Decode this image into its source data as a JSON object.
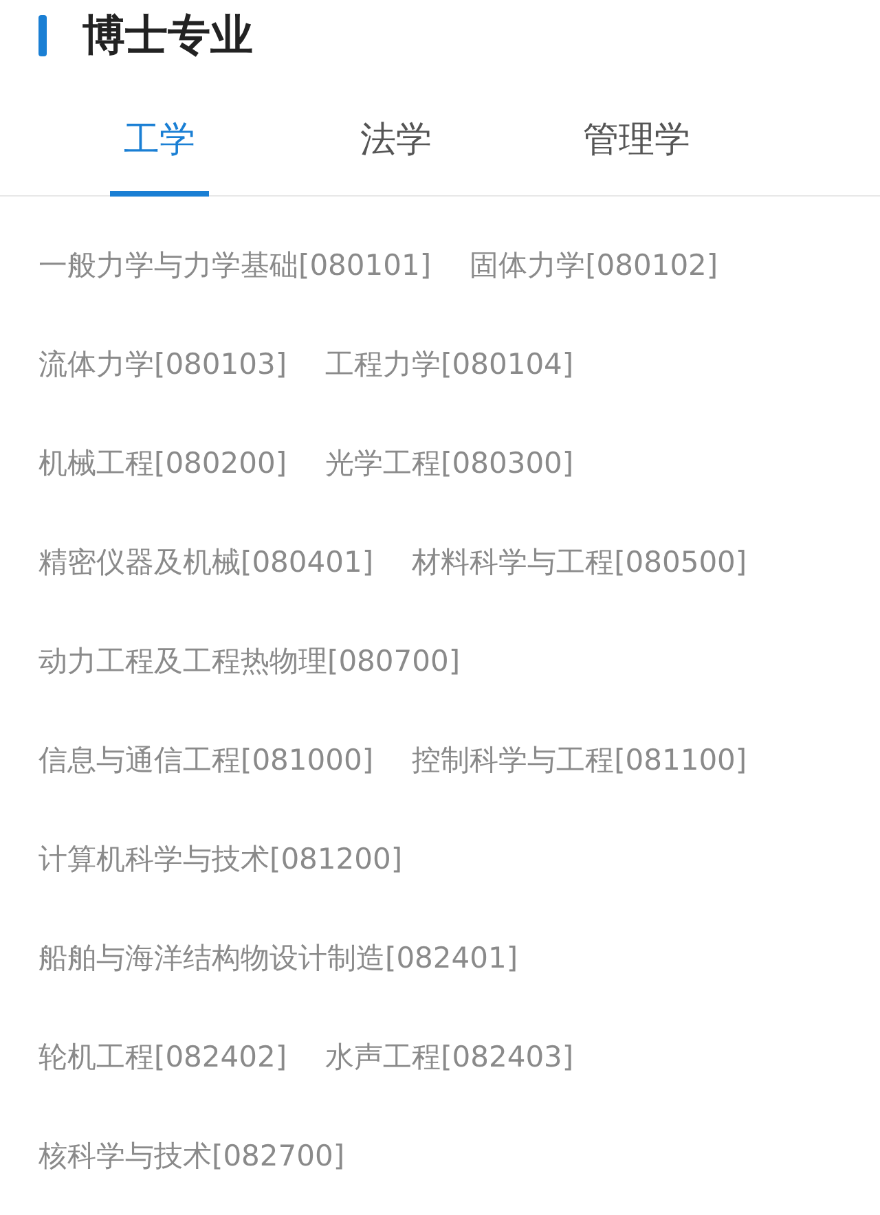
{
  "header": {
    "title": "博士专业"
  },
  "tabs": [
    {
      "label": "工学",
      "selected": true
    },
    {
      "label": "法学",
      "selected": false
    },
    {
      "label": "管理学",
      "selected": false
    }
  ],
  "majors": [
    {
      "items": [
        "一般力学与力学基础[080101]",
        "固体力学[080102]"
      ]
    },
    {
      "items": [
        "流体力学[080103]",
        "工程力学[080104]"
      ]
    },
    {
      "items": [
        "机械工程[080200]",
        "光学工程[080300]"
      ]
    },
    {
      "items": [
        "精密仪器及机械[080401]",
        "材料科学与工程[080500]"
      ]
    },
    {
      "items": [
        "动力工程及工程热物理[080700]"
      ]
    },
    {
      "items": [
        "信息与通信工程[081000]",
        "控制科学与工程[081100]"
      ]
    },
    {
      "items": [
        "计算机科学与技术[081200]"
      ]
    },
    {
      "items": [
        "船舶与海洋结构物设计制造[082401]"
      ]
    },
    {
      "items": [
        "轮机工程[082402]",
        "水声工程[082403]"
      ]
    },
    {
      "items": [
        "核科学与技术[082700]"
      ]
    }
  ]
}
